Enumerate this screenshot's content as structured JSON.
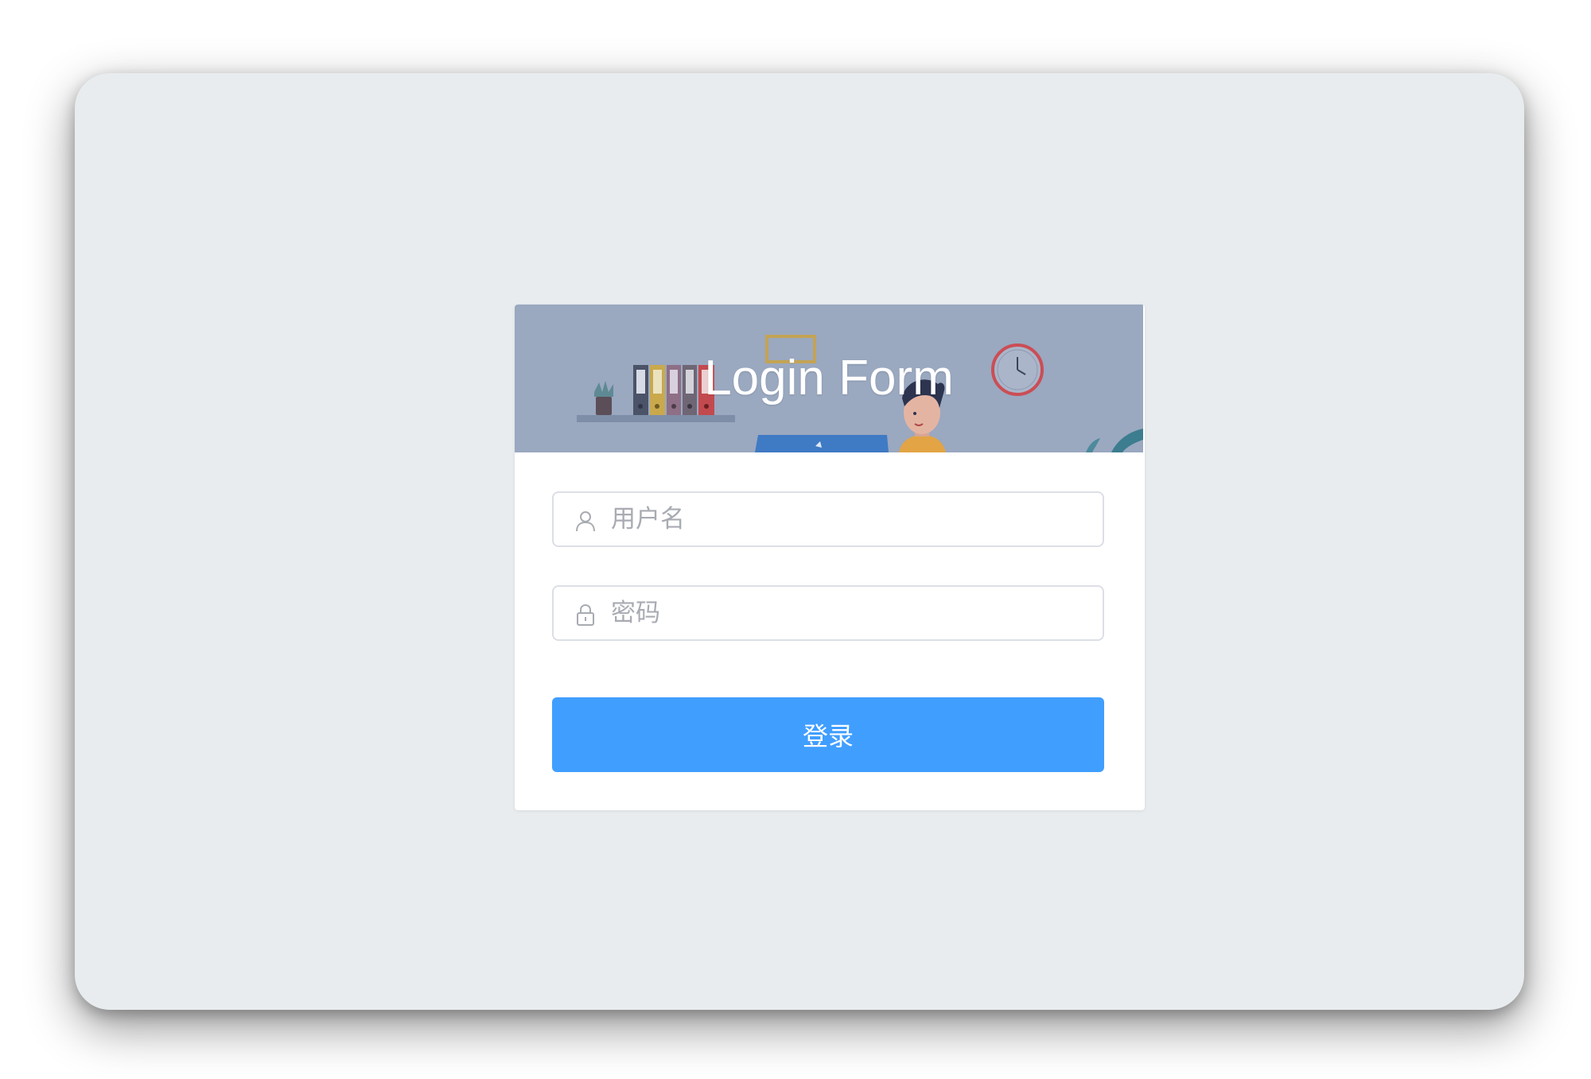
{
  "header": {
    "title": "Login Form"
  },
  "form": {
    "username": {
      "placeholder": "用户名",
      "value": ""
    },
    "password": {
      "placeholder": "密码",
      "value": ""
    },
    "submit_label": "登录"
  },
  "icons": {
    "username": "user-icon",
    "password": "lock-icon"
  },
  "colors": {
    "background": "#e8ecee",
    "banner": "#9aa8c0",
    "primary": "#409eff",
    "input_border": "#dcdfe6",
    "placeholder": "#a8abb2"
  }
}
